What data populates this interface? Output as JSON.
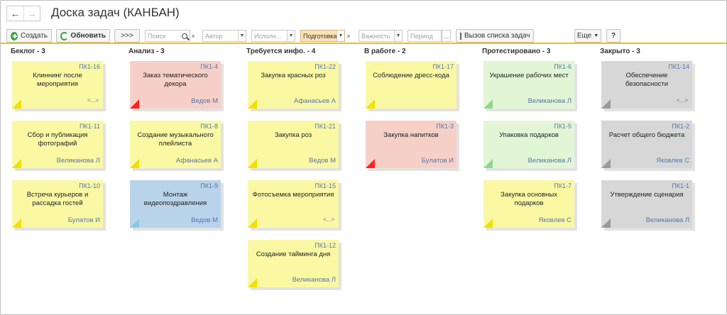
{
  "window": {
    "title": "Доска задач (КАНБАН)"
  },
  "nav": {
    "back_icon": "arrow-left-icon",
    "forward_icon": "arrow-right-icon"
  },
  "toolbar": {
    "create_label": "Создать",
    "refresh_label": "Обновить",
    "expand_label": ">>>",
    "search_placeholder": "Поиск",
    "author_placeholder": "Автор",
    "assignee_placeholder": "Исполн...",
    "stage_value": "Подготовка",
    "importance_placeholder": "Важность",
    "period_placeholder": "Период",
    "period_btn": "...",
    "task_list_label": "Вызов списка задач",
    "more_label": "Еще",
    "help_label": "?",
    "accent_color": "#f2c100"
  },
  "columns": [
    {
      "title": "Беклог - 3",
      "cards": [
        {
          "id": "ПК1-16",
          "title": "Клиннинг после мероприятия",
          "user": "",
          "more": "<...>",
          "color": "yellow"
        },
        {
          "id": "ПК1-11",
          "title": "Сбор и публикация фотографий",
          "user": "Великанова Л",
          "more": "",
          "color": "yellow"
        },
        {
          "id": "ПК1-10",
          "title": "Встреча курьеров и рассадка гостей",
          "user": "Булатов И",
          "more": "",
          "color": "yellow"
        }
      ]
    },
    {
      "title": "Анализ - 3",
      "cards": [
        {
          "id": "ПК1-4",
          "title": "Заказ тематического декора",
          "user": "Ведов М",
          "more": "",
          "color": "red"
        },
        {
          "id": "ПК1-8",
          "title": "Создание музыкального плейлиста",
          "user": "Афанасьев А",
          "more": "",
          "color": "yellow"
        },
        {
          "id": "ПК1-9",
          "title": "Монтаж видеопоздравления",
          "user": "Ведов М",
          "more": "",
          "color": "blue"
        }
      ]
    },
    {
      "title": "Требуется инфо. - 4",
      "cards": [
        {
          "id": "ПК1-22",
          "title": "Закупка красных роз",
          "user": "Афанасьев А",
          "more": "",
          "color": "yellow"
        },
        {
          "id": "ПК1-21",
          "title": "Закупка роз",
          "user": "Ведов М",
          "more": "",
          "color": "yellow"
        },
        {
          "id": "ПК1-15",
          "title": "Фотосъемка мероприятия",
          "user": "",
          "more": "<...>",
          "color": "yellow"
        },
        {
          "id": "ПК1-12",
          "title": "Создание тайминга дня",
          "user": "Великанова Л",
          "more": "",
          "color": "yellow"
        }
      ]
    },
    {
      "title": "В работе - 2",
      "cards": [
        {
          "id": "ПК1-17",
          "title": "Соблюдение дресс-кода",
          "user": "",
          "more": "",
          "color": "yellow"
        },
        {
          "id": "ПК1-3",
          "title": "Закупка напитков",
          "user": "Булатов И",
          "more": "",
          "color": "red"
        }
      ]
    },
    {
      "title": "Протестировано - 3",
      "cards": [
        {
          "id": "ПК1-6",
          "title": "Украшение рабочих мест",
          "user": "Великанова Л",
          "more": "",
          "color": "green"
        },
        {
          "id": "ПК1-5",
          "title": "Упаковка подарков",
          "user": "Великанова Л",
          "more": "",
          "color": "green"
        },
        {
          "id": "ПК1-7",
          "title": "Закупка основных подарков",
          "user": "Яковлев С",
          "more": "",
          "color": "yellow"
        }
      ]
    },
    {
      "title": "Закрыто - 3",
      "cards": [
        {
          "id": "ПК1-14",
          "title": "Обеспечение безопасности",
          "user": "",
          "more": "<...>",
          "color": "gray"
        },
        {
          "id": "ПК1-2",
          "title": "Расчет общего бюджета",
          "user": "Яковлев С",
          "more": "",
          "color": "gray"
        },
        {
          "id": "ПК1-1",
          "title": "Утверждение сценария",
          "user": "Великанова Л",
          "more": "",
          "color": "gray"
        }
      ]
    }
  ]
}
